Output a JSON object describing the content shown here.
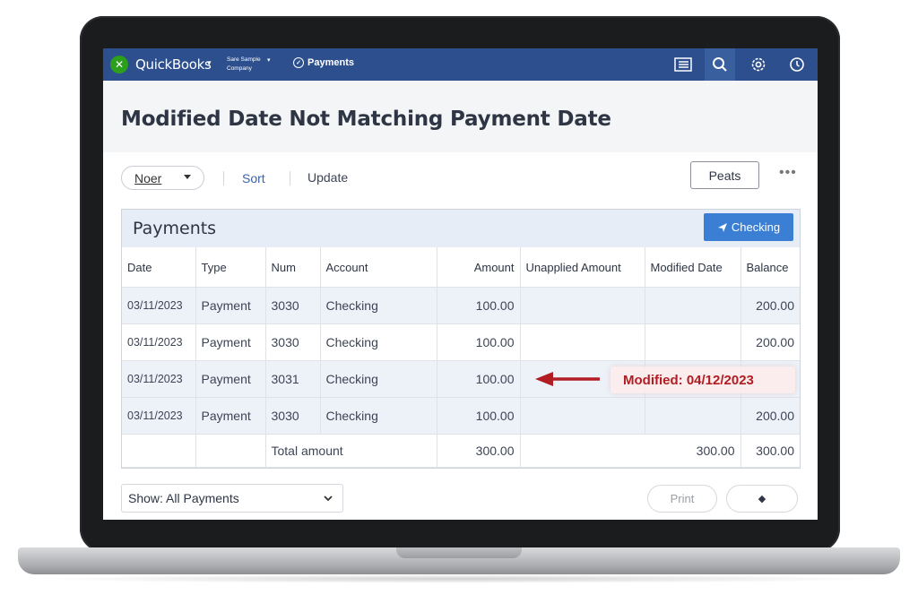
{
  "app": {
    "brand": "QuickBooks",
    "company_line1": "Sare Sample",
    "company_line2": "Company",
    "nav_label": "Payments"
  },
  "page": {
    "title": "Modified Date Not Matching Payment Date"
  },
  "toolbar": {
    "filter_label": "Noer",
    "sort_label": "Sort",
    "update_label": "Update",
    "peats_label": "Peats",
    "more_label": "•••"
  },
  "panel": {
    "title": "Payments",
    "checking_button": "Checking",
    "columns": [
      "Date",
      "Type",
      "Num",
      "Account",
      "Amount",
      "Unapplied Amount",
      "Modified Date",
      "Balance"
    ],
    "rows": [
      {
        "date": "03/11/2023",
        "type": "Payment",
        "num": "3030",
        "account": "Checking",
        "amount": "100.00",
        "unapplied": "",
        "modified": "",
        "balance": "200.00"
      },
      {
        "date": "03/11/2023",
        "type": "Payment",
        "num": "3030",
        "account": "Checking",
        "amount": "100.00",
        "unapplied": "",
        "modified": "",
        "balance": "200.00"
      },
      {
        "date": "03/11/2023",
        "type": "Payment",
        "num": "3031",
        "account": "Checking",
        "amount": "100.00",
        "unapplied": "",
        "modified": "",
        "balance": ""
      },
      {
        "date": "03/11/2023",
        "type": "Payment",
        "num": "3030",
        "account": "Checking",
        "amount": "100.00",
        "unapplied": "",
        "modified": "",
        "balance": "200.00"
      }
    ],
    "total": {
      "label": "Total amount",
      "amount": "300.00",
      "unapplied": "300.00",
      "balance": "300.00"
    }
  },
  "annotation": {
    "callout": "Modified: 04/12/2023",
    "color": "#b11d22"
  },
  "footer": {
    "show_label": "Show: All Payments",
    "print_label": "Print",
    "nav_symbol": "◆"
  },
  "colors": {
    "topbar": "#2d4f8e",
    "accent_button": "#3b7fd4",
    "logo_green": "#2ca01c"
  }
}
